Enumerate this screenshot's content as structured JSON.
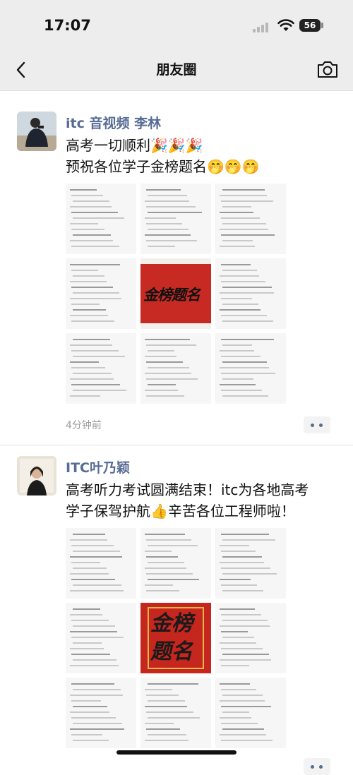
{
  "status_bar": {
    "time": "17:07",
    "battery_level": "56"
  },
  "nav": {
    "title": "朋友圈",
    "back_icon": "chevron-left-icon",
    "camera_icon": "camera-icon"
  },
  "posts": [
    {
      "author": "itc 音视频 李林",
      "text": "高考一切顺利🎉🎉🎉\n预祝各位学子金榜题名🤭🤭🤭",
      "time": "4分钟前",
      "center_image_text": "金榜题名"
    },
    {
      "author": "ITC叶乃颖",
      "text": "高考听力考试圆满结束！itc为各地高考\n学子保驾护航👍辛苦各位工程师啦！",
      "time": "",
      "center_image_text": "金榜题名"
    }
  ]
}
